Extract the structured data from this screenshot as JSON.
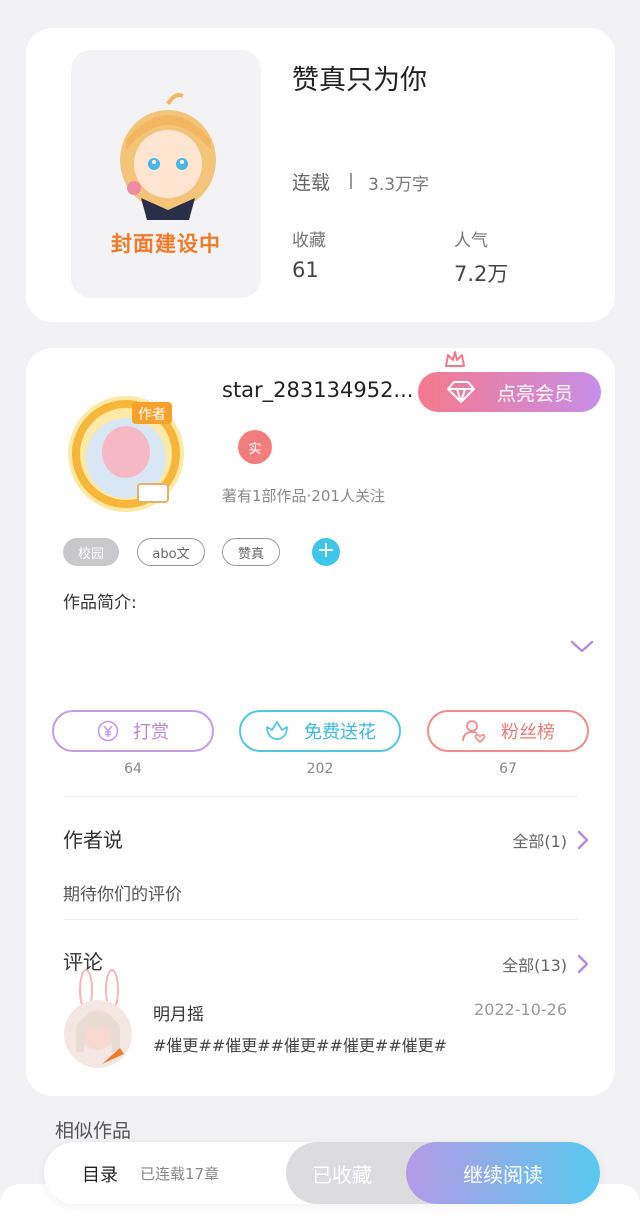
{
  "book": {
    "cover_text": "封面建设中",
    "title": "赞真只为你",
    "status": "连载",
    "word_count": "3.3万字",
    "favorites_label": "收藏",
    "favorites_value": "61",
    "popularity_label": "人气",
    "popularity_value": "7.2万"
  },
  "author": {
    "name": "star_283134952...",
    "vip_label": "点亮会员",
    "real_badge": "实",
    "meta": "著有1部作品·201人关注"
  },
  "tags": [
    "校园",
    "abo文",
    "赞真"
  ],
  "tag_add": "+",
  "intro_label": "作品简介:",
  "actions": {
    "reward_label": "打赏",
    "reward_count": "64",
    "flower_label": "免费送花",
    "flower_count": "202",
    "fans_label": "粉丝榜",
    "fans_count": "67"
  },
  "author_says": {
    "title": "作者说",
    "more": "全部(1)",
    "content": "期待你们的评价"
  },
  "comments": {
    "title": "评论",
    "more": "全部(13)",
    "items": [
      {
        "user": "明月摇",
        "date": "2022-10-26",
        "text": "#催更##催更##催更##催更##催更#"
      }
    ]
  },
  "similar_label": "相似作品",
  "bottom_bar": {
    "toc_label": "目录",
    "chapters": "已连载17章",
    "collected_label": "已收藏",
    "continue_label": "继续阅读"
  },
  "colors": {
    "accent_purple": "#c78ee8",
    "accent_blue": "#58c9ef",
    "accent_pink": "#f47a8c",
    "cover_orange": "#ef7a2b"
  },
  "icons": [
    "diamond-icon",
    "crown-icon",
    "yen-icon",
    "flower-icon",
    "fan-user-icon",
    "chevron-down-icon",
    "chevron-right-icon"
  ]
}
